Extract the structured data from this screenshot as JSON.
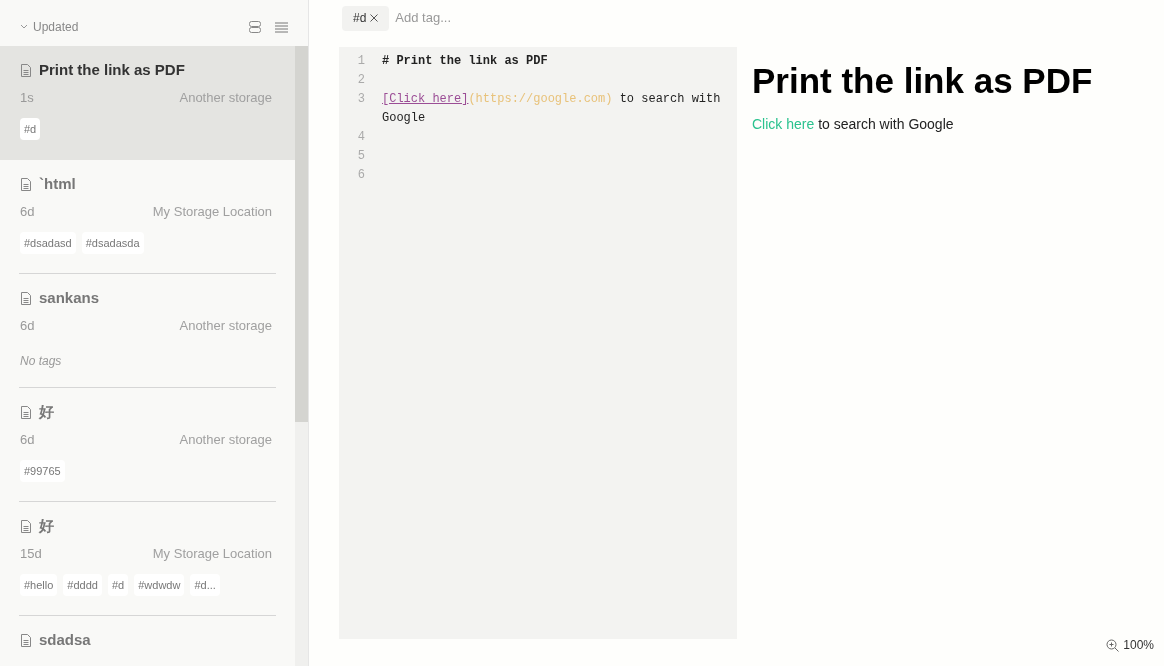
{
  "sidebar": {
    "sort_label": "Updated",
    "notes": [
      {
        "title": "Print the link as PDF",
        "time": "1s",
        "storage": "Another storage",
        "tags": [
          "#d"
        ],
        "selected": true
      },
      {
        "title": "`html",
        "time": "6d",
        "storage": "My Storage Location",
        "tags": [
          "#dsadasd",
          "#dsadasda"
        ],
        "selected": false
      },
      {
        "title": "sankans",
        "time": "6d",
        "storage": "Another storage",
        "no_tags": "No tags",
        "selected": false
      },
      {
        "title": "好",
        "time": "6d",
        "storage": "Another storage",
        "tags": [
          "#99765"
        ],
        "selected": false
      },
      {
        "title": "好",
        "time": "15d",
        "storage": "My Storage Location",
        "tags": [
          "#hello",
          "#dddd",
          "#d",
          "#wdwdw",
          "#d..."
        ],
        "selected": false
      },
      {
        "title": "sdadsa",
        "selected": false
      }
    ]
  },
  "tag_bar": {
    "tags": [
      "#d"
    ],
    "placeholder": "Add tag..."
  },
  "editor": {
    "lines": [
      {
        "number": "1",
        "segments": [
          {
            "kind": "heading",
            "text": "# Print the link as PDF"
          }
        ]
      },
      {
        "number": "2"
      },
      {
        "number": "3",
        "segments": [
          {
            "kind": "link",
            "text": "[Click here]"
          },
          {
            "kind": "url",
            "text": "(https://google.com)"
          },
          {
            "kind": "plain",
            "text": " to search with Google"
          }
        ]
      },
      {
        "number": "4"
      },
      {
        "number": "5"
      },
      {
        "number": "6"
      }
    ]
  },
  "preview": {
    "heading": "Print the link as PDF",
    "link": "Click here",
    "text": " to search with Google"
  },
  "zoom": "100%"
}
